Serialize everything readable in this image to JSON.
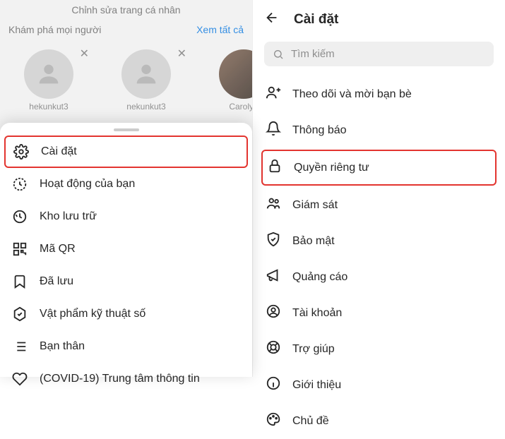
{
  "left": {
    "edit_profile": "Chỉnh sửa trang cá nhân",
    "discover_label": "Khám phá mọi người",
    "see_all": "Xem tất cả",
    "suggestions": [
      {
        "name": "hekunkut3"
      },
      {
        "name": "nekunkut3"
      },
      {
        "name": "Carolyn"
      }
    ],
    "menu": [
      {
        "key": "settings",
        "label": "Cài đặt",
        "highlight": true
      },
      {
        "key": "activity",
        "label": "Hoạt động của bạn"
      },
      {
        "key": "archive",
        "label": "Kho lưu trữ"
      },
      {
        "key": "qr",
        "label": "Mã QR"
      },
      {
        "key": "saved",
        "label": "Đã lưu"
      },
      {
        "key": "digital",
        "label": "Vật phẩm kỹ thuật số"
      },
      {
        "key": "close-friends",
        "label": "Bạn thân"
      },
      {
        "key": "covid",
        "label": "(COVID-19) Trung tâm thông tin"
      }
    ]
  },
  "right": {
    "title": "Cài đặt",
    "search_placeholder": "Tìm kiếm",
    "items": [
      {
        "key": "follow",
        "label": "Theo dõi và mời bạn bè"
      },
      {
        "key": "notifications",
        "label": "Thông báo"
      },
      {
        "key": "privacy",
        "label": "Quyền riêng tư",
        "highlight": true
      },
      {
        "key": "supervision",
        "label": "Giám sát"
      },
      {
        "key": "security",
        "label": "Bảo mật"
      },
      {
        "key": "ads",
        "label": "Quảng cáo"
      },
      {
        "key": "account",
        "label": "Tài khoản"
      },
      {
        "key": "help",
        "label": "Trợ giúp"
      },
      {
        "key": "about",
        "label": "Giới thiệu"
      },
      {
        "key": "theme",
        "label": "Chủ đề"
      }
    ]
  }
}
